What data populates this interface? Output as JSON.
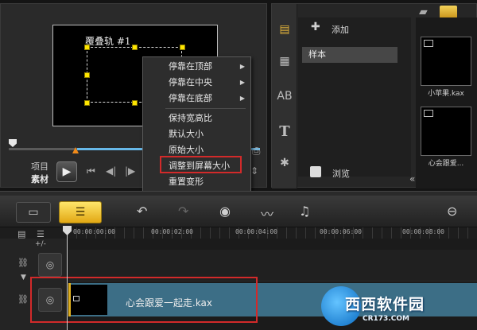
{
  "preview": {
    "track_title": "覆叠轨 #1",
    "mode_project": "项目",
    "mode_clip": "素材",
    "play_symbol": "▶",
    "transport": [
      "⏮",
      "◀|",
      "|▶",
      "⏭"
    ]
  },
  "context_menu": {
    "items": [
      {
        "label": "停靠在顶部",
        "submenu": true
      },
      {
        "label": "停靠在中央",
        "submenu": true
      },
      {
        "label": "停靠在底部",
        "submenu": true
      },
      {
        "label": "保持宽高比",
        "submenu": false
      },
      {
        "label": "默认大小",
        "submenu": false
      },
      {
        "label": "原始大小",
        "submenu": false
      },
      {
        "label": "调整到屏幕大小",
        "submenu": false
      },
      {
        "label": "重置变形",
        "submenu": false
      }
    ],
    "highlighted_index": 6
  },
  "library": {
    "add_label": "添加",
    "selected_item": "样本",
    "browse_label": "浏览",
    "thumbnails": [
      {
        "label": "小苹果.kax"
      },
      {
        "label": "心会跟爱..."
      }
    ]
  },
  "timeline": {
    "ruler": [
      "00:00:00:00",
      "00:00:02:00",
      "00:00:04:00",
      "00:00:06:00",
      "00:00:08:00"
    ],
    "clip_name": "心会跟爱一起走.kax",
    "add_remove": "+/-"
  },
  "watermark": {
    "text": "西西软件园",
    "sub": "CR173.COM"
  },
  "colors": {
    "accent_yellow": "#ffe600",
    "clip_blue": "#3c6e86",
    "highlight_red": "#d22a2a",
    "scrub_blue": "#67b8e8"
  }
}
